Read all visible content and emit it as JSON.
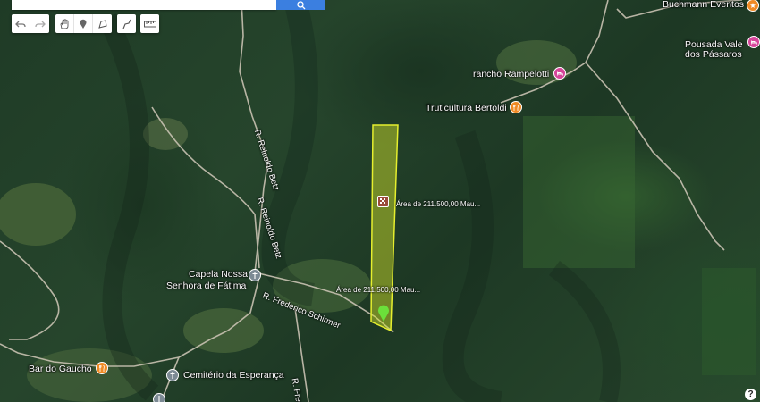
{
  "search": {
    "placeholder": ""
  },
  "toolbar": {
    "nav": [
      "undo-arrow-icon",
      "redo-arrow-icon"
    ],
    "tools": [
      "hand-icon",
      "placemark-icon",
      "polygon-icon",
      "path-icon",
      "ruler-icon"
    ]
  },
  "places": {
    "buchmann": "Buchmann Eventos",
    "pousada_1": "Pousada Vale",
    "pousada_2": "dos Pássaros",
    "rancho": "rancho Rampelotti",
    "truticultura": "Truticultura Bertoldi",
    "capela_1": "Capela Nossa",
    "capela_2": "Senhora de Fátima",
    "bar": "Bar do Gaucho",
    "cemiterio": "Cemitério da Esperança"
  },
  "roads": {
    "reinoldo_upper": "R. Reinoldo Betz",
    "reinoldo_lower": "R. Reinoldo Betz",
    "frederico": "R. Frederico Schirmer",
    "fred_edge": "R. Fred"
  },
  "parcel": {
    "label_upper": "Área de 211.500,00 Mau...",
    "label_lower": "Área de 211.500,00 Mau..."
  },
  "colors": {
    "poi_pink": "#d6459a",
    "poi_orange": "#f08a24",
    "poi_gray": "#7c8a94",
    "parcel_fill": "#d9e82a",
    "parcel_stroke": "#e6ef2e",
    "marker": "#6be03a",
    "search_button": "#3b7fe0"
  },
  "help": "?"
}
